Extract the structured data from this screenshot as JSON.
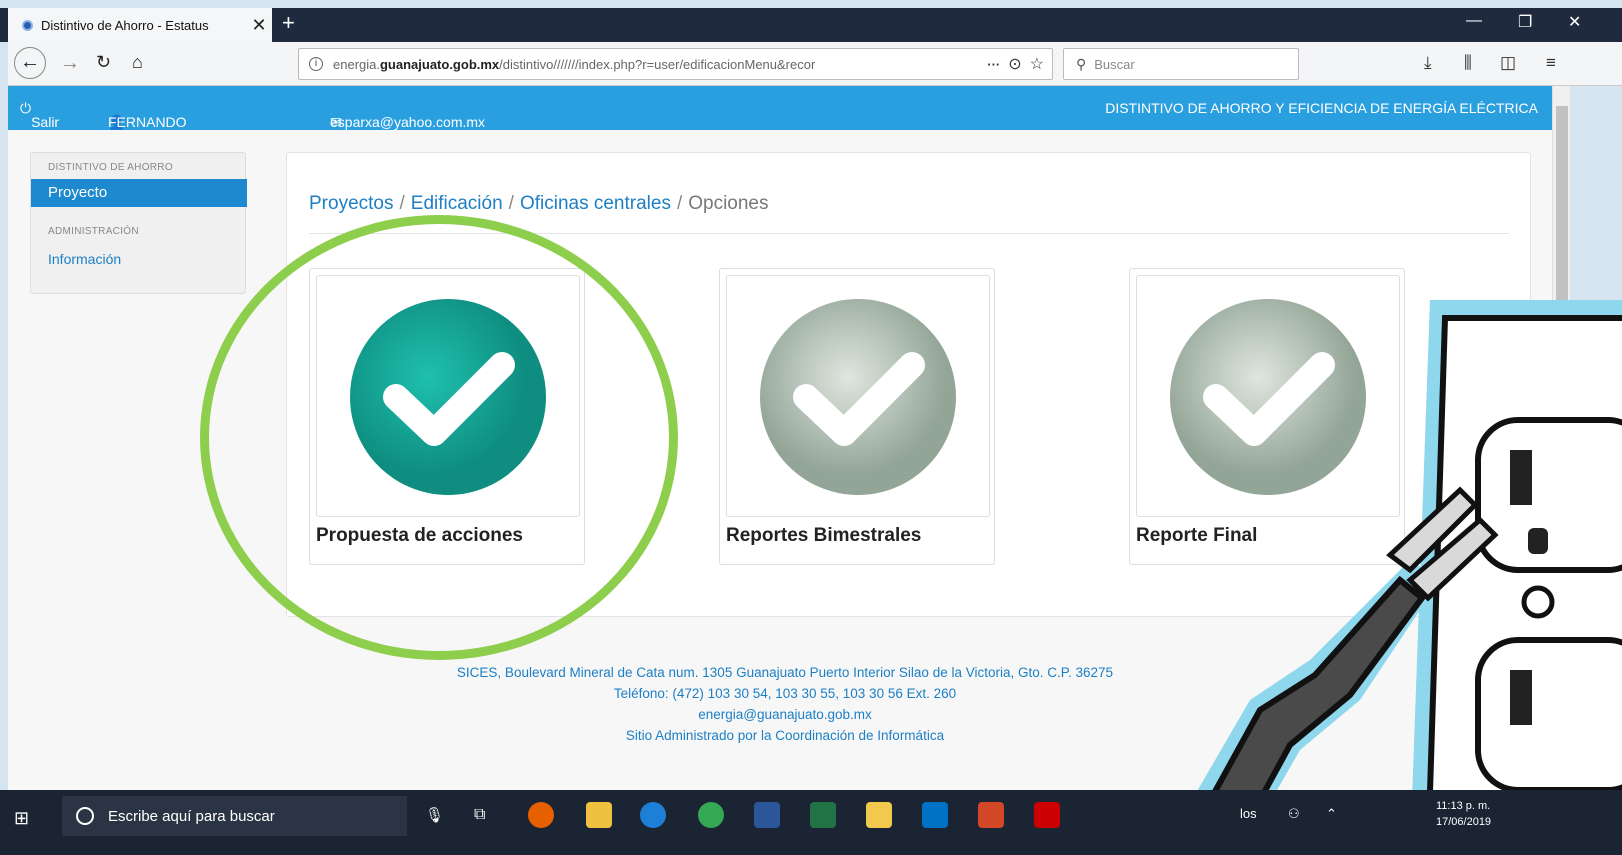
{
  "browser": {
    "tab_title": "Distintivo de Ahorro - Estatus",
    "tab_close": "✕",
    "new_tab": "+",
    "url_prefix": "energia.",
    "url_domain": "guanajuato.gob.mx",
    "url_path": "/distintivo///////index.php?r=user/edificacionMenu&recor",
    "url_more": "···",
    "search_placeholder": "Buscar"
  },
  "site_header": {
    "logout": "Salir",
    "user_name": "FERNANDO ESPARZA",
    "user_email": "esparxa@yahoo.com.mx",
    "program_title": "DISTINTIVO DE AHORRO Y EFICIENCIA DE ENERGÍA ELÉCTRICA"
  },
  "sidebar": {
    "section1_header": "DISTINTIVO DE AHORRO",
    "section1_active": "Proyecto",
    "section2_header": "ADMINISTRACIÓN",
    "section2_link": "Información"
  },
  "breadcrumb": {
    "items": [
      "Proyectos",
      "Edificación",
      "Oficinas centrales"
    ],
    "current": "Opciones",
    "separator": "/"
  },
  "cards": [
    {
      "label": "Propuesta de acciones",
      "status": "active"
    },
    {
      "label": "Reportes Bimestrales",
      "status": "inactive"
    },
    {
      "label": "Reporte Final",
      "status": "inactive"
    }
  ],
  "footer": {
    "address": "SICES, Boulevard Mineral de Cata num. 1305 Guanajuato Puerto Interior Silao de la Victoria, Gto. C.P. 36275",
    "phone": "Teléfono: (472) 103 30 54, 103 30 55, 103 30 56 Ext. 260",
    "email": "energia@guanajuato.gob.mx",
    "admin": "Sitio Administrado por la Coordinación de Informática"
  },
  "taskbar": {
    "search_placeholder": "Escribe aquí para buscar",
    "time": "11:13 p. m.",
    "date": "17/06/2019",
    "tray_text": "los"
  },
  "colors": {
    "accent": "#2a9fe0",
    "highlight": "#8dce4d",
    "active_check": "#16a596",
    "inactive_check": "#a9b8ac"
  }
}
